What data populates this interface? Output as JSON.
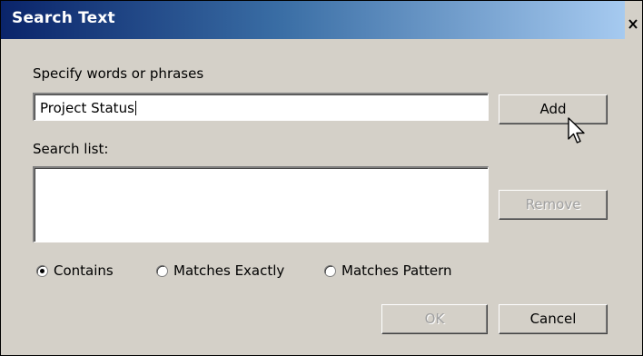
{
  "window": {
    "title": "Search Text",
    "close_label": "X",
    "titlebar_gradient": [
      "#0a246a",
      "#a6caf0"
    ],
    "face_color": "#d4d0c8"
  },
  "words": {
    "label": "Specify words or phrases",
    "input_value": "Project Status",
    "add_label": "Add"
  },
  "search_list": {
    "label": "Search list:",
    "items": [],
    "remove_label": "Remove",
    "remove_enabled": false
  },
  "match_mode": {
    "options": [
      {
        "label": "Contains",
        "selected": true
      },
      {
        "label": "Matches Exactly",
        "selected": false
      },
      {
        "label": "Matches Pattern",
        "selected": false
      }
    ]
  },
  "footer": {
    "ok_label": "OK",
    "ok_enabled": false,
    "cancel_label": "Cancel"
  },
  "pointer": {
    "icon": "mouse-pointer-icon"
  }
}
